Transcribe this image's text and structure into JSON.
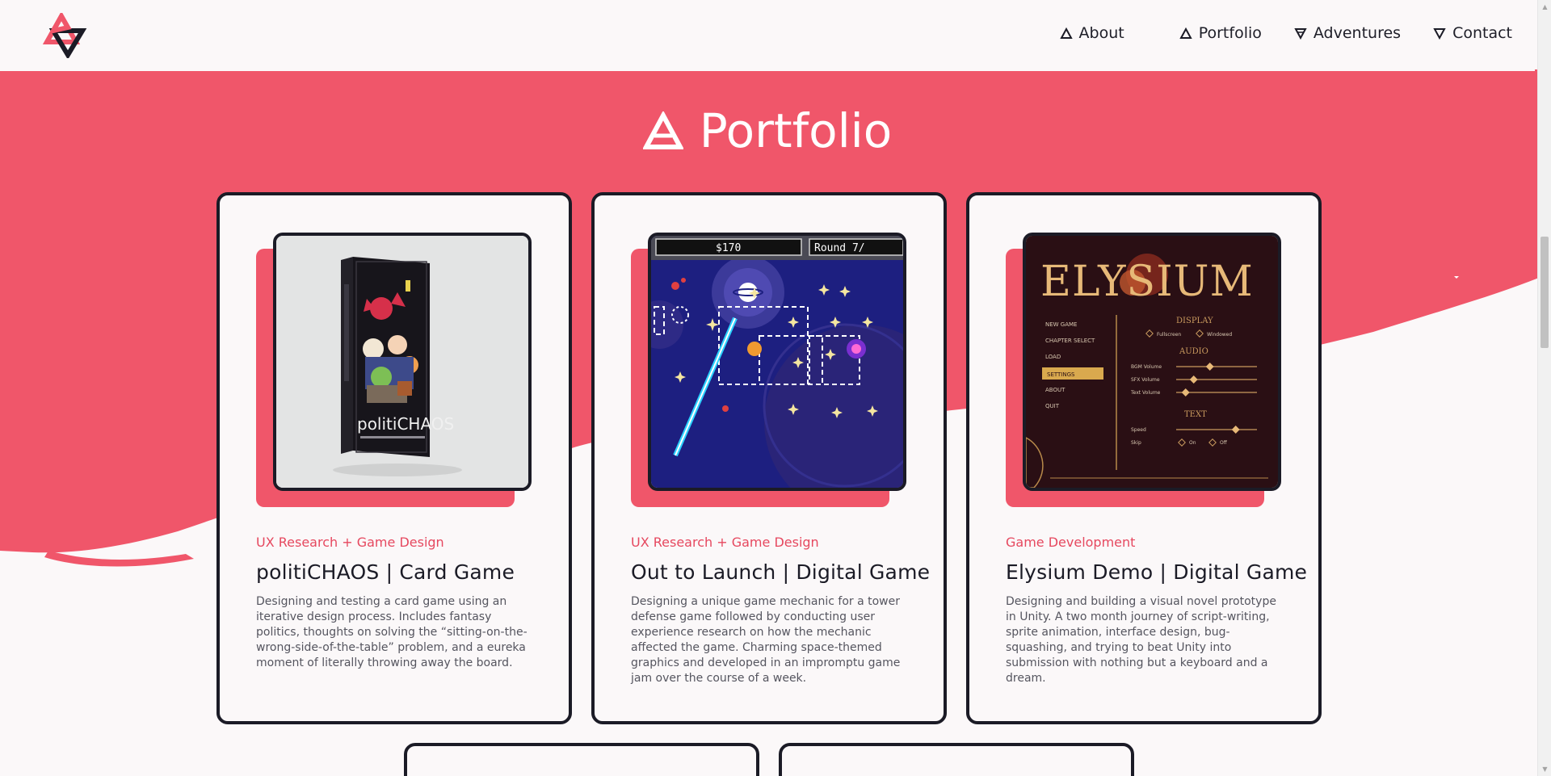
{
  "header": {
    "logo_name": "site-logo",
    "nav": [
      {
        "label": "About",
        "icon": "triangle-up-icon"
      },
      {
        "label": "Portfolio",
        "icon": "triangle-up-icon"
      },
      {
        "label": "Adventures",
        "icon": "triangle-down-icon"
      },
      {
        "label": "Contact",
        "icon": "triangle-down-icon"
      }
    ]
  },
  "section": {
    "title": "Portfolio",
    "icon": "triangle-up-icon"
  },
  "cards": [
    {
      "category": "UX Research + Game Design",
      "title": "politiCHAOS | Card Game",
      "description": "Designing and testing a card game using an iterative design process. Includes fantasy politics, thoughts on solving the “sitting-on-the-wrong-side-of-the-table” problem, and a eureka moment of literally throwing away the board.",
      "image": {
        "box_brand": "politiCHAOS"
      }
    },
    {
      "category": "UX Research + Game Design",
      "title": "Out to Launch | Digital Game",
      "description": "Designing a unique game mechanic for a tower defense game followed by conducting user experience research on how the mechanic affected the game. Charming space-themed graphics and developed in an impromptu game jam over the course of a week.",
      "image": {
        "money": "$170",
        "round": "Round 7/"
      }
    },
    {
      "category": "Game Development",
      "title": "Elysium Demo | Digital Game",
      "description": "Designing and building a visual novel prototype in Unity. A two month journey of script-writing, sprite animation, interface design, bug-squashing, and trying to beat Unity into submission with nothing but a keyboard and a dream.",
      "image": {
        "logo": "ELYSIUM",
        "menu": [
          "NEW GAME",
          "CHAPTER SELECT",
          "LOAD",
          "SETTINGS",
          "ABOUT",
          "QUIT"
        ],
        "display_label": "DISPLAY",
        "display_options": [
          "Fullscreen",
          "Windowed"
        ],
        "audio_label": "AUDIO",
        "audio_options": [
          "BGM Volume",
          "SFX Volume",
          "Text Volume"
        ],
        "text_label": "TEXT",
        "text_options": [
          "Speed",
          "Skip"
        ],
        "skip_options": [
          "On",
          "Off"
        ]
      }
    }
  ],
  "colors": {
    "accent": "#f0566a",
    "accent_text": "#e6485f",
    "ink": "#1b1b26",
    "background": "#fbf8f9"
  }
}
